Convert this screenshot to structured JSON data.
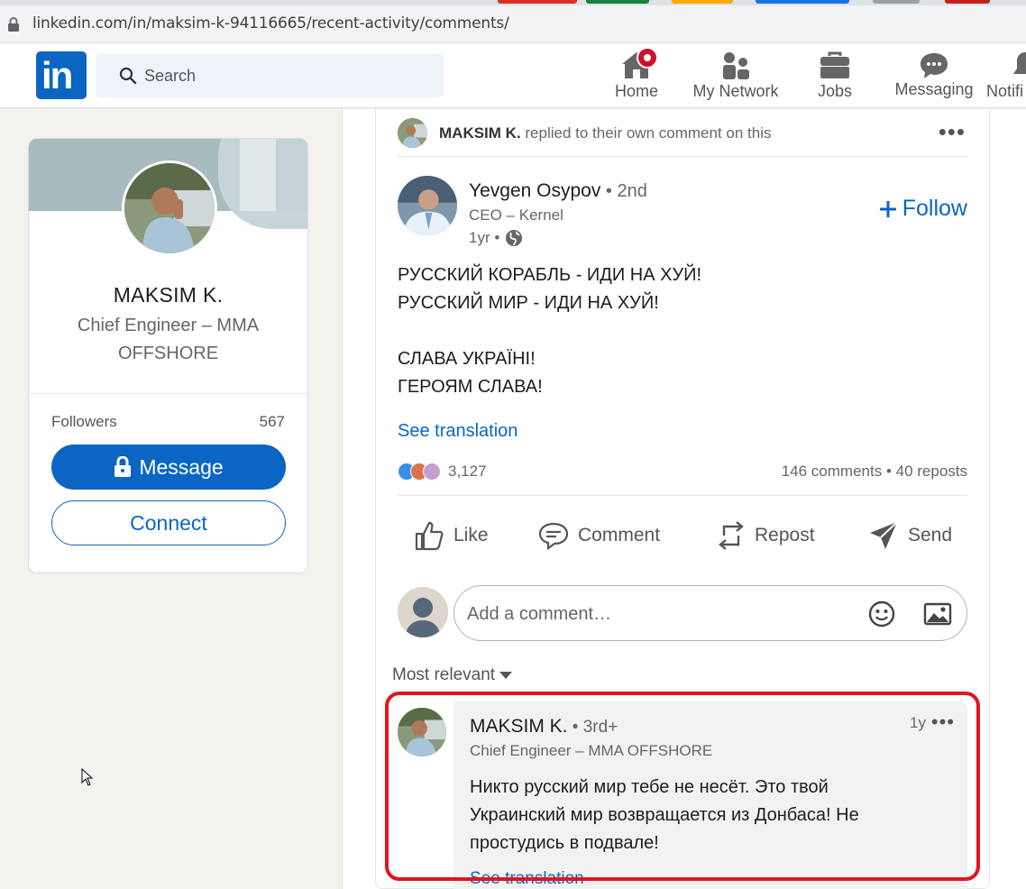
{
  "browser": {
    "url": "linkedin.com/in/maksim-k-94116665/recent-activity/comments/"
  },
  "nav": {
    "search_placeholder": "Search",
    "items": [
      {
        "label": "Home"
      },
      {
        "label": "My Network"
      },
      {
        "label": "Jobs"
      },
      {
        "label": "Messaging"
      },
      {
        "label": "Notifi"
      }
    ]
  },
  "profile": {
    "name": "MAKSIM K.",
    "headline": "Chief Engineer – MMA OFFSHORE",
    "followers_label": "Followers",
    "followers_count": "567",
    "message_label": "Message",
    "connect_label": "Connect"
  },
  "activity": {
    "actor": "MAKSIM K.",
    "action": " replied to their own comment on this"
  },
  "post": {
    "author_name": "Yevgen Osypov",
    "author_degree": " • 2nd",
    "author_headline": "CEO – Kernel",
    "time": "1yr •",
    "follow_label": "Follow",
    "lines": [
      "РУССКИЙ КОРАБЛЬ - ИДИ НА ХУЙ!",
      "РУССКИЙ МИР - ИДИ НА ХУЙ!",
      "",
      "СЛАВА УКРАЇНІ!",
      "ГЕРОЯМ СЛАВА!"
    ],
    "see_translation": "See translation",
    "reaction_count": "3,127",
    "stats": "146 comments • 40 reposts"
  },
  "actions": {
    "like": "Like",
    "comment": "Comment",
    "repost": "Repost",
    "send": "Send"
  },
  "comment_input": {
    "placeholder": "Add a comment…"
  },
  "sort_label": "Most relevant",
  "comment": {
    "author_name": "MAKSIM K.",
    "author_degree": " • 3rd+",
    "author_headline": "Chief Engineer – MMA OFFSHORE",
    "time": "1y",
    "text": "Никто русский мир тебе не несёт. Это твой Украинский мир возвращается из Донбаса! Не простудись в подвале!",
    "see_translation": "See translation"
  },
  "colors": {
    "brand": "#0a66c2",
    "highlight": "#e2141e",
    "badge": "#cb112d"
  }
}
